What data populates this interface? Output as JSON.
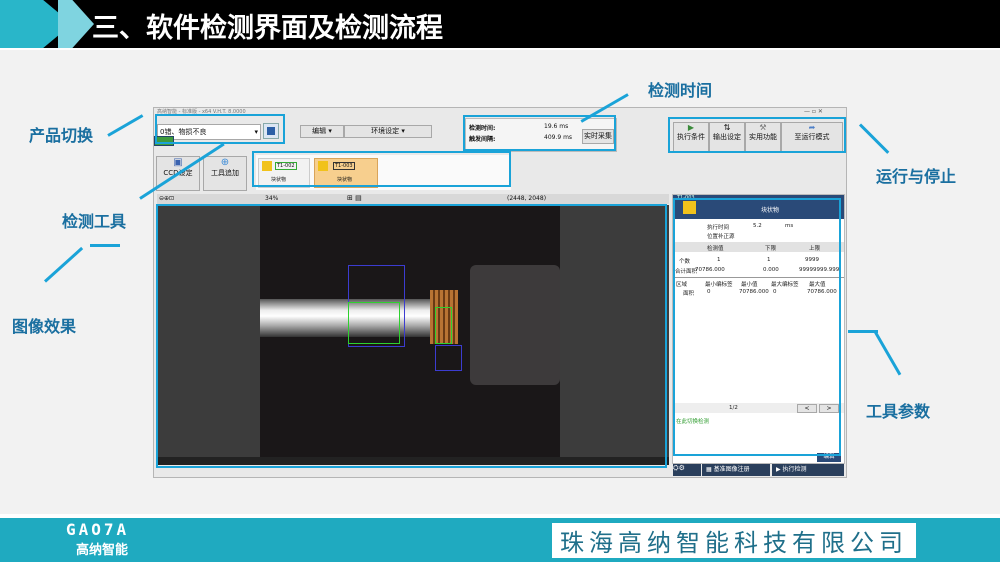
{
  "header": {
    "title": "三、软件检测界面及检测流程"
  },
  "footer": {
    "logo_text": "GAO7A",
    "logo_cn": "高纳智能",
    "company": "珠海高纳智能科技有限公司"
  },
  "window": {
    "title": "高纳智能 - 标准版 - x64 V.H.T. 8.0000",
    "product_select": "0错、物损不良",
    "menu_edit": "编辑",
    "menu_env": "环境设定",
    "detect_time_label": "检测时间:",
    "detect_time_value": "19.6 ms",
    "trigger_label": "触发间隔:",
    "trigger_value": "409.9 ms",
    "realtime_btn": "实时采集",
    "btn_exec": "执行条件",
    "btn_output": "输出设定",
    "btn_util": "实用功能",
    "btn_run": "至运行模式",
    "ccd_btn": "CCD设定",
    "tool_add_btn": "工具追加",
    "tools": [
      {
        "id": "T1-002",
        "name": "块状物"
      },
      {
        "id": "T1-003",
        "name": "块状物"
      }
    ],
    "zoom": "34%",
    "resolution": "(2448, 2048)",
    "panel": {
      "tool_id": "T1-003",
      "tool_name": "块状物",
      "exec_time_label": "执行时间",
      "exec_time_value": "5.2",
      "exec_time_unit": "ms",
      "pos_correct": "位置补正源",
      "headers": [
        "检测值",
        "下限",
        "上限"
      ],
      "rows": [
        {
          "name": "个数",
          "v": "1",
          "lo": "1",
          "hi": "9999"
        },
        {
          "name": "合计面积",
          "v": "70786.000",
          "lo": "0.000",
          "hi": "99999999.999"
        }
      ],
      "list_headers": [
        "区域",
        "最小编标签",
        "最小值",
        "最大编标签",
        "最大值"
      ],
      "list_row": [
        "面积",
        "0",
        "70786.000",
        "0",
        "70786.000"
      ],
      "page": "1/2",
      "hint": "在此切换检测",
      "edit_btn": "编辑",
      "btn_register": "基准图像注册",
      "btn_exec_detect": "执行检测"
    }
  },
  "annotations": {
    "product_switch": "产品切换",
    "detect_time": "检测时间",
    "run_stop": "运行与停止",
    "detect_tool": "检测工具",
    "image_effect": "图像效果",
    "tool_params": "工具参数"
  }
}
